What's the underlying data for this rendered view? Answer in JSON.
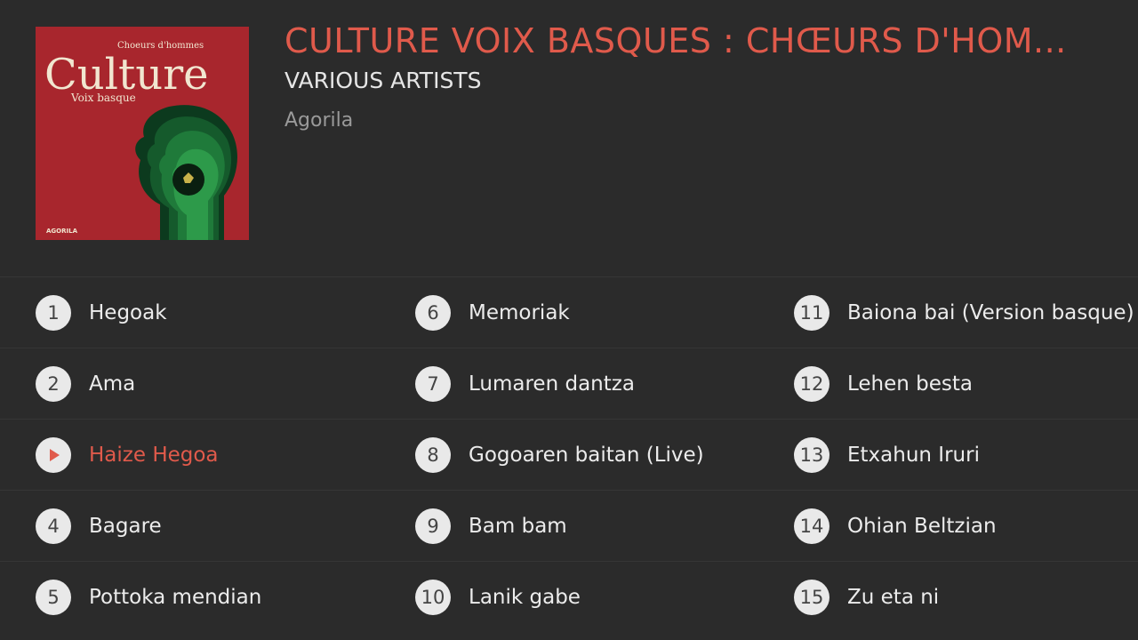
{
  "album": {
    "title": "CULTURE VOIX BASQUES : CHŒURS D'HOM...",
    "artist": "VARIOUS ARTISTS",
    "label": "Agorila",
    "cover": {
      "line1": "Choeurs d'hommes",
      "line2": "Culture",
      "line3": "Voix basque",
      "logo": "AGORILA"
    }
  },
  "colors": {
    "accent": "#e05a4b",
    "background": "#2b2b2b",
    "text": "#ececec",
    "muted": "#9a9a9a",
    "cover_red": "#a8262d"
  },
  "tracks": [
    {
      "num": "1",
      "name": "Hegoak"
    },
    {
      "num": "2",
      "name": "Ama"
    },
    {
      "num": "3",
      "name": "Haize Hegoa",
      "playing": true,
      "icon": "play-icon"
    },
    {
      "num": "4",
      "name": "Bagare"
    },
    {
      "num": "5",
      "name": "Pottoka mendian"
    },
    {
      "num": "6",
      "name": "Memoriak"
    },
    {
      "num": "7",
      "name": "Lumaren dantza"
    },
    {
      "num": "8",
      "name": "Gogoaren baitan (Live)"
    },
    {
      "num": "9",
      "name": "Bam bam"
    },
    {
      "num": "10",
      "name": "Lanik gabe"
    },
    {
      "num": "11",
      "name": "Baiona bai (Version basque)"
    },
    {
      "num": "12",
      "name": "Lehen besta"
    },
    {
      "num": "13",
      "name": "Etxahun Iruri"
    },
    {
      "num": "14",
      "name": "Ohian Beltzian"
    },
    {
      "num": "15",
      "name": "Zu eta ni"
    }
  ]
}
